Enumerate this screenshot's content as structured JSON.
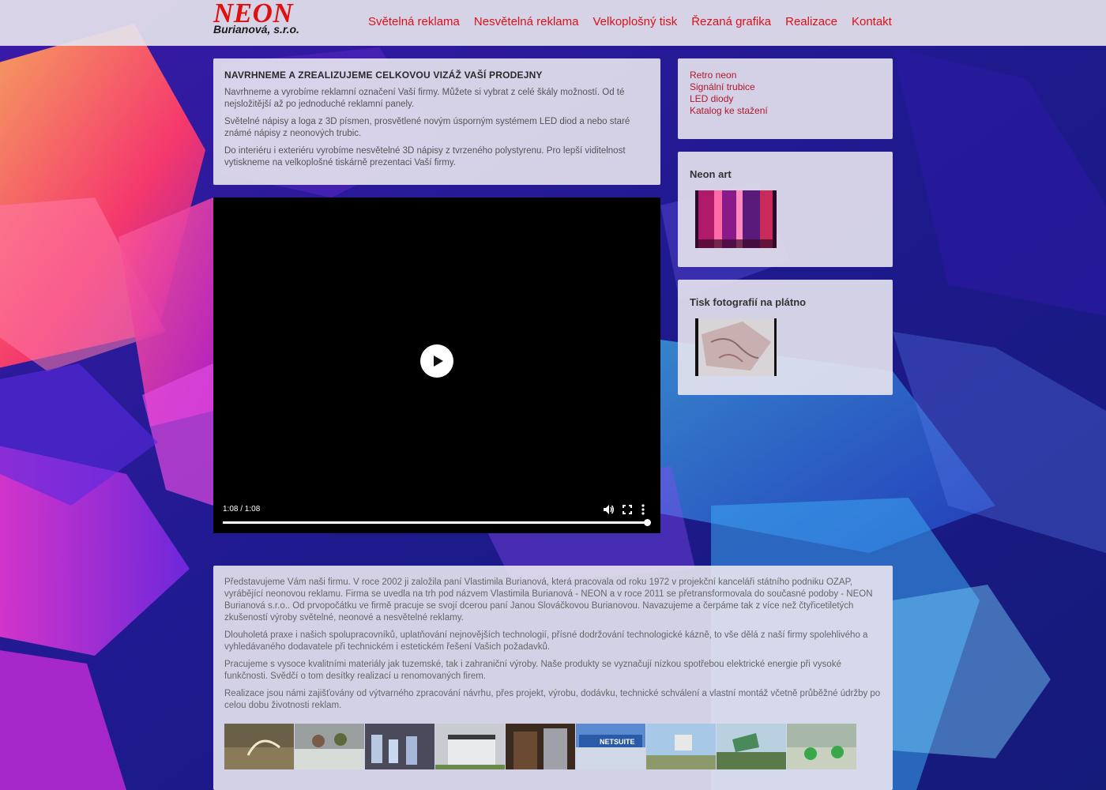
{
  "logo": {
    "main": "NEON",
    "sub": "Burianová, s.r.o."
  },
  "nav": [
    "Světelná reklama",
    "Nesvětelná reklama",
    "Velkoplošný tisk",
    "Řezaná grafika",
    "Realizace",
    "Kontakt"
  ],
  "intro": {
    "title": "NAVRHNEME A ZREALIZUJEME CELKOVOU VIZÁŽ VAŠÍ PRODEJNY",
    "paragraphs": [
      "Navrhneme a vyrobíme reklamní označení Vaší firmy. Můžete si vybrat z celé škály možností. Od té nejsložitější až po jednoduché reklamní panely.",
      "Světelné nápisy a loga z 3D písmen, prosvětlené novým úsporným systémem LED diod a nebo staré známé nápisy z neonových trubic.",
      "Do interiéru i exteriéru vyrobíme nesvětelné 3D nápisy z tvrzeného polystyrenu. Pro lepší viditelnost vytiskneme na velkoplošné tiskárně prezentaci Vaší firmy."
    ]
  },
  "video": {
    "time": "1:08 / 1:08",
    "progress": 1.0
  },
  "sidebar": {
    "links": [
      "Retro neon",
      "Signální trubice",
      "LED diody",
      "Katalog ke stažení"
    ],
    "box1_title": "Neon art",
    "box2_title": "Tisk fotografií na plátno"
  },
  "about": {
    "paragraphs": [
      "Představujeme Vám naši firmu. V roce 2002 ji založila paní Vlastimila Burianová, která pracovala od roku 1972 v projekční kanceláři státního podniku OZAP, vyrábějící neonovou reklamu. Firma se uvedla na trh pod názvem Vlastimila Burianová - NEON a v roce 2011 se přetransformovala do současné podoby - NEON Burianová s.r.o.. Od prvopočátku ve firmě pracuje se svojí dcerou paní Janou Slováčkovou Burianovou. Navazujeme a čerpáme tak z více než čtyřicetiletých zkušeností výroby světelné, neonové a nesvětelné reklamy.",
      "Dlouholetá praxe i našich spolupracovníků, uplatňování nejnovějších technologií, přísné dodržování technologické kázně, to vše dělá z naší firmy spolehlivého a vyhledávaného dodavatele při technickém i estetickém řešení Vašich požadavků.",
      "Pracujeme s vysoce kvalitními materiály jak tuzemské, tak i zahraniční výroby. Naše produkty se vyznačují nízkou spotřebou elektrické energie při vysoké funkčnosti. Svědčí o tom desítky realizací u renomovaných firem.",
      "Realizace jsou námi zajišťovány od výtvarného zpracování návrhu, přes projekt, výrobu, dodávku, technické schválení a vlastní montáž včetně průběžné údržby po celou dobu životnosti reklam."
    ],
    "gallery_sign_text": "NETSUITE"
  },
  "colors": {
    "nav": "#d8121b",
    "logo": "#e01010",
    "sidebar_link": "#b0182b"
  }
}
